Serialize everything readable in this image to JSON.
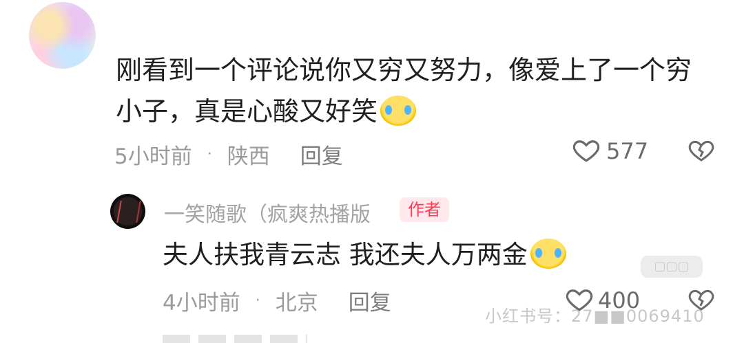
{
  "top_comment": {
    "username": "",
    "text": "刚看到一个评论说你又穷又努力，像爱上了一个穷小子，真是心酸又好笑",
    "emoji": "crying-laughing-emoji",
    "time": "5小时前",
    "location": "陕西",
    "reply_label": "回复",
    "like_count": "577"
  },
  "reply": {
    "username": "一笑随歌（疯爽热播版",
    "author_badge": "作者",
    "text": "夫人扶我青云志 我还夫人万两金",
    "emoji": "crying-emoji",
    "time": "4小时前",
    "location": "北京",
    "reply_label": "回复",
    "like_count": "400"
  },
  "watermark": "小红书号：27■■0069410",
  "colors": {
    "badge_bg": "#ffe9ec",
    "badge_text": "#ff3b57",
    "meta_text": "#9b9b9b"
  }
}
